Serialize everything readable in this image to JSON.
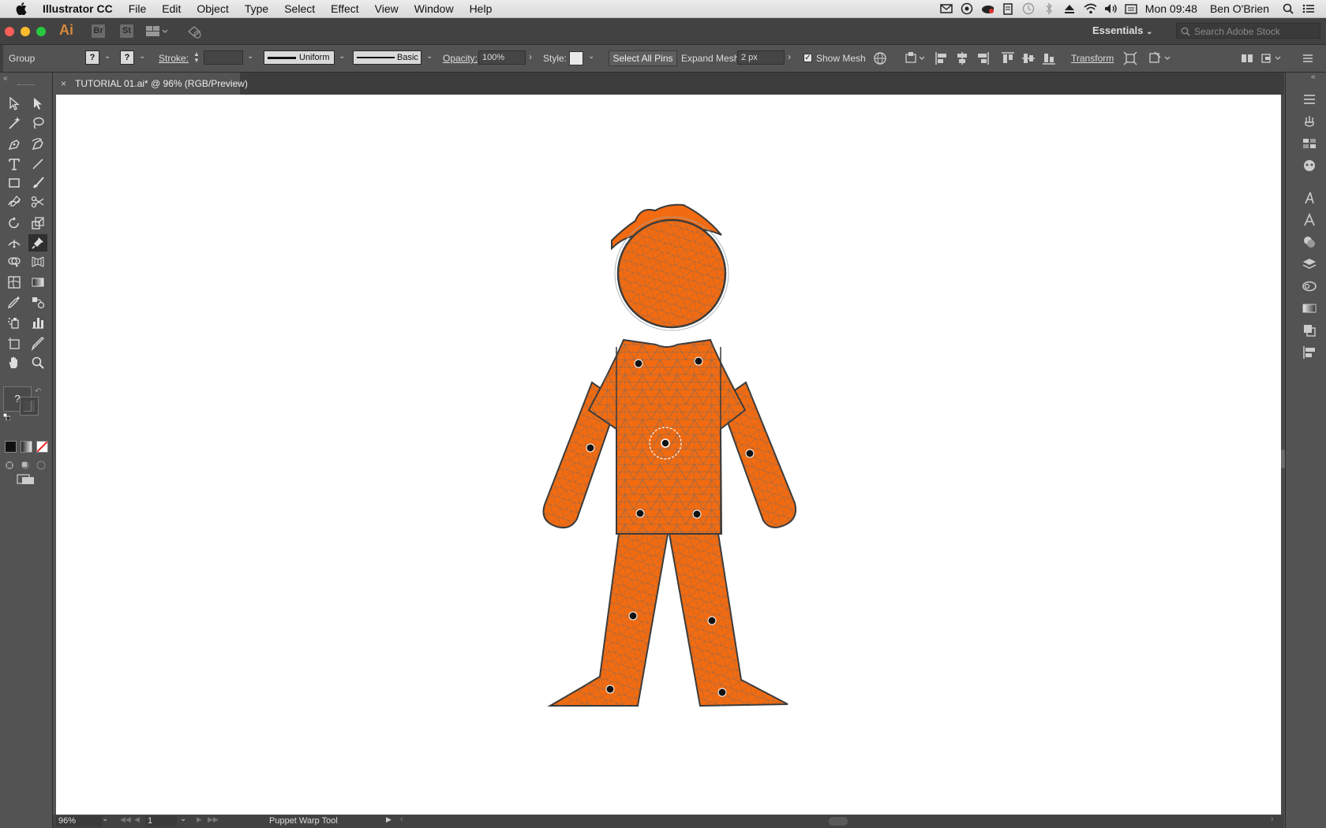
{
  "menubar": {
    "app_name": "Illustrator CC",
    "items": [
      "File",
      "Edit",
      "Object",
      "Type",
      "Select",
      "Effect",
      "View",
      "Window",
      "Help"
    ],
    "clock": "Mon 09:48",
    "user": "Ben O'Brien"
  },
  "appbar": {
    "logo": "Ai",
    "bridge": "Br",
    "stock": "St",
    "workspace": "Essentials",
    "search_placeholder": "Search Adobe Stock"
  },
  "control": {
    "selection": "Group",
    "fill_value": "?",
    "stroke_swatch_value": "?",
    "stroke_label": "Stroke:",
    "profile": "Uniform",
    "brush": "Basic",
    "opacity_label": "Opacity:",
    "opacity_value": "100%",
    "style_label": "Style:",
    "select_all_pins": "Select All Pins",
    "expand_mesh_label": "Expand Mesh:",
    "expand_mesh_value": "2 px",
    "show_mesh_label": "Show Mesh",
    "show_mesh_checked": true,
    "transform": "Transform"
  },
  "document": {
    "tab_title": "TUTORIAL 01.ai* @ 96% (RGB/Preview)"
  },
  "colors": {
    "figure_fill": "#f26b10",
    "mesh_line": "#5e6a74",
    "pin": "#111111"
  },
  "status": {
    "zoom": "96%",
    "artboard": "1",
    "tool": "Puppet Warp Tool"
  },
  "left_toolbar": {
    "fill_stroke_unknown": "?"
  }
}
